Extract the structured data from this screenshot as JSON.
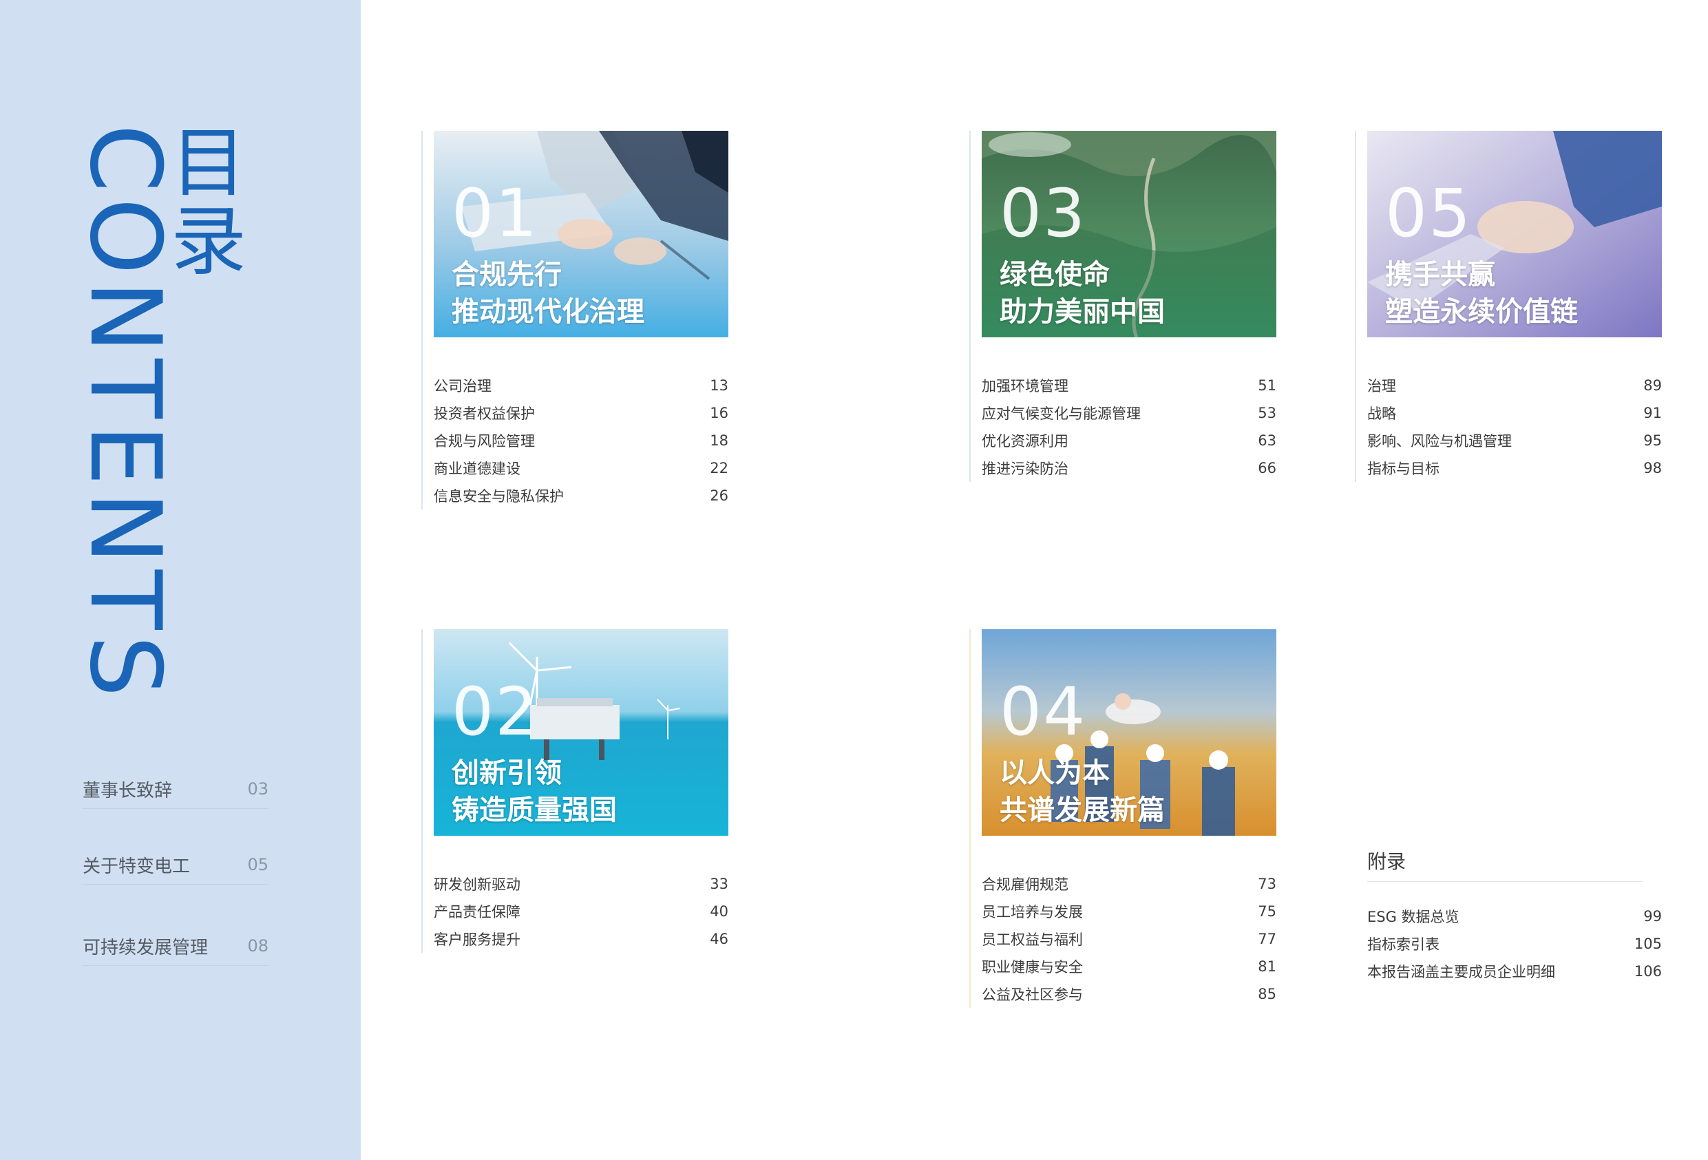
{
  "sidebar": {
    "title": "目录",
    "subtitle": "CONTENTS",
    "links": [
      {
        "label": "董事长致辞",
        "page": "03"
      },
      {
        "label": "关于特变电工",
        "page": "05"
      },
      {
        "label": "可持续发展管理",
        "page": "08"
      }
    ]
  },
  "chapters": [
    {
      "num": "01",
      "line1": "合规先行",
      "line2": "推动现代化治理",
      "items": [
        {
          "label": "公司治理",
          "page": "13"
        },
        {
          "label": "投资者权益保护",
          "page": "16"
        },
        {
          "label": "合规与风险管理",
          "page": "18"
        },
        {
          "label": "商业道德建设",
          "page": "22"
        },
        {
          "label": "信息安全与隐私保护",
          "page": "26"
        }
      ]
    },
    {
      "num": "02",
      "line1": "创新引领",
      "line2": "铸造质量强国",
      "items": [
        {
          "label": "研发创新驱动",
          "page": "33"
        },
        {
          "label": "产品责任保障",
          "page": "40"
        },
        {
          "label": "客户服务提升",
          "page": "46"
        }
      ]
    },
    {
      "num": "03",
      "line1": "绿色使命",
      "line2": "助力美丽中国",
      "items": [
        {
          "label": "加强环境管理",
          "page": "51"
        },
        {
          "label": "应对气候变化与能源管理",
          "page": "53"
        },
        {
          "label": "优化资源利用",
          "page": "63"
        },
        {
          "label": "推进污染防治",
          "page": "66"
        }
      ]
    },
    {
      "num": "04",
      "line1": "以人为本",
      "line2": "共谱发展新篇",
      "items": [
        {
          "label": "合规雇佣规范",
          "page": "73"
        },
        {
          "label": "员工培养与发展",
          "page": "75"
        },
        {
          "label": "员工权益与福利",
          "page": "77"
        },
        {
          "label": "职业健康与安全",
          "page": "81"
        },
        {
          "label": "公益及社区参与",
          "page": "85"
        }
      ]
    },
    {
      "num": "05",
      "line1": "携手共赢",
      "line2": "塑造永续价值链",
      "items": [
        {
          "label": "治理",
          "page": "89"
        },
        {
          "label": "战略",
          "page": "91"
        },
        {
          "label": "影响、风险与机遇管理",
          "page": "95"
        },
        {
          "label": "指标与目标",
          "page": "98"
        }
      ]
    }
  ],
  "appendix": {
    "title": "附录",
    "items": [
      {
        "label": "ESG 数据总览",
        "page": "99"
      },
      {
        "label": "指标索引表",
        "page": "105"
      },
      {
        "label": "本报告涵盖主要成员企业明细",
        "page": "106"
      }
    ]
  },
  "colors": {
    "sidebar_bg": "#d0e0f2",
    "brand_blue": "#1a65b8",
    "chapter01": "#4fb0e0",
    "chapter02": "#1aa7cf",
    "chapter03": "#2f8a5a",
    "chapter04": "#d99a3a",
    "chapter05": "#8a83c9"
  }
}
